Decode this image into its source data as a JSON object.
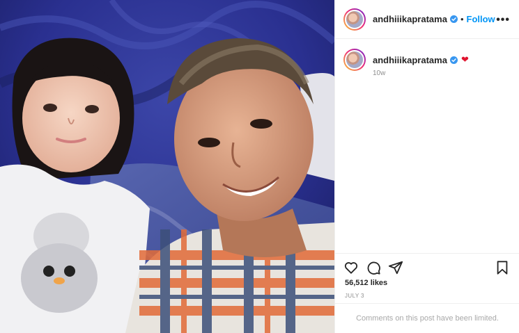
{
  "header": {
    "username": "andhiiikapratama",
    "follow_label": "Follow",
    "separator": "•",
    "more_label": "•••"
  },
  "caption": {
    "username": "andhiiikapratama",
    "emoji": "❤",
    "time_ago": "10w"
  },
  "actions": {
    "icons": [
      "heart-icon",
      "comment-icon",
      "share-icon",
      "bookmark-icon"
    ]
  },
  "likes": "56,512 likes",
  "date": "JULY 3",
  "comments_limited": "Comments on this post have been limited.",
  "colors": {
    "accent": "#0095f6",
    "verified": "#3897f0",
    "heart": "#e0142f",
    "muted": "#8e8e8e"
  }
}
